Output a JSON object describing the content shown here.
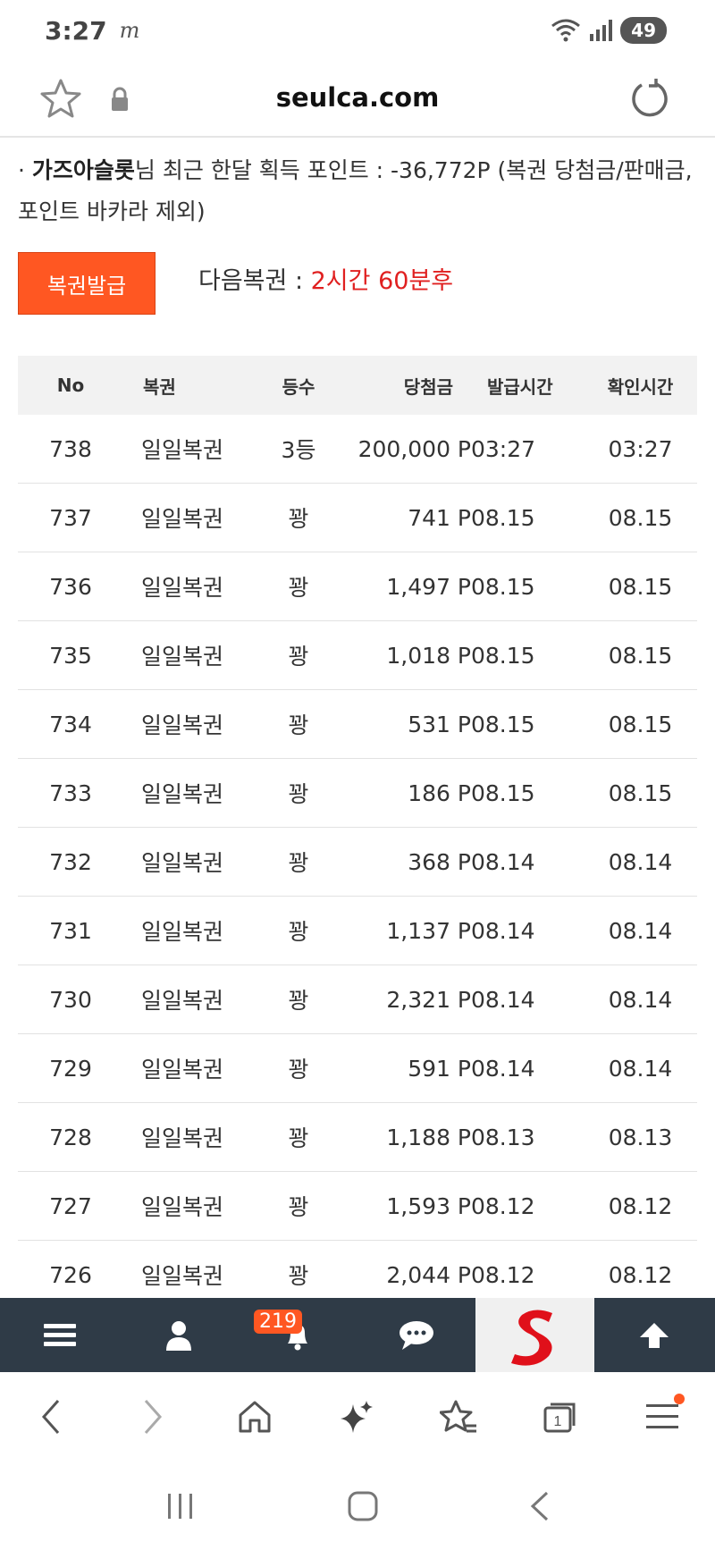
{
  "status": {
    "time": "3:27",
    "notification": "m",
    "battery": "49"
  },
  "browser": {
    "url": "seulca.com"
  },
  "info": {
    "prefix": "· ",
    "user": "가즈아슬롯",
    "text": "님 최근 한달 획득 포인트 : -36,772P (복권 당첨금/판매금, 포인트 바카라 제외)"
  },
  "issue_button": "복권발급",
  "next_lottery": {
    "label": "다음복권 : ",
    "value": "2시간 60분후"
  },
  "table": {
    "headers": [
      "No",
      "복권",
      "등수",
      "당첨금",
      "발급시간",
      "확인시간"
    ],
    "rows": [
      [
        "738",
        "일일복권",
        "3등",
        "200,000 P",
        "03:27",
        "03:27"
      ],
      [
        "737",
        "일일복권",
        "꽝",
        "741 P",
        "08.15",
        "08.15"
      ],
      [
        "736",
        "일일복권",
        "꽝",
        "1,497 P",
        "08.15",
        "08.15"
      ],
      [
        "735",
        "일일복권",
        "꽝",
        "1,018 P",
        "08.15",
        "08.15"
      ],
      [
        "734",
        "일일복권",
        "꽝",
        "531 P",
        "08.15",
        "08.15"
      ],
      [
        "733",
        "일일복권",
        "꽝",
        "186 P",
        "08.15",
        "08.15"
      ],
      [
        "732",
        "일일복권",
        "꽝",
        "368 P",
        "08.14",
        "08.14"
      ],
      [
        "731",
        "일일복권",
        "꽝",
        "1,137 P",
        "08.14",
        "08.14"
      ],
      [
        "730",
        "일일복권",
        "꽝",
        "2,321 P",
        "08.14",
        "08.14"
      ],
      [
        "729",
        "일일복권",
        "꽝",
        "591 P",
        "08.14",
        "08.14"
      ],
      [
        "728",
        "일일복권",
        "꽝",
        "1,188 P",
        "08.13",
        "08.13"
      ],
      [
        "727",
        "일일복권",
        "꽝",
        "1,593 P",
        "08.12",
        "08.12"
      ],
      [
        "726",
        "일일복권",
        "꽝",
        "2,044 P",
        "08.12",
        "08.12"
      ]
    ]
  },
  "site_nav": {
    "notification_count": "219",
    "items": [
      "menu-icon",
      "user-icon",
      "bell-icon",
      "chat-icon",
      "logo",
      "arrow-up-icon"
    ]
  },
  "colors": {
    "accent": "#ff5722",
    "highlight": "#e02020",
    "nav_bg": "#2f3b47"
  }
}
